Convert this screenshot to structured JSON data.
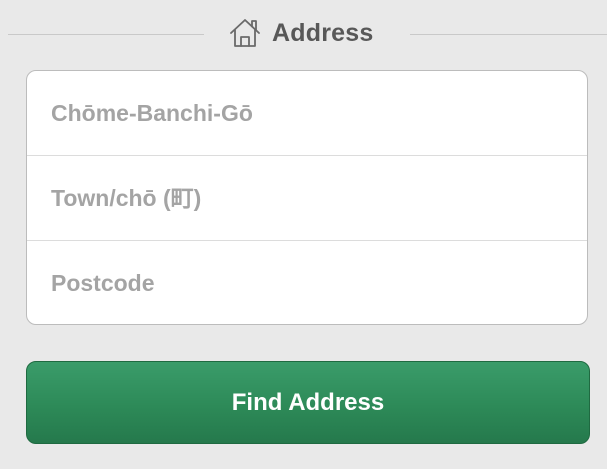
{
  "section_header": {
    "icon": "house-icon",
    "title": "Address"
  },
  "address_form": {
    "fields": [
      {
        "placeholder": "Chōme-Banchi-Gō",
        "value": ""
      },
      {
        "placeholder": "Town/chō (町)",
        "value": ""
      },
      {
        "placeholder": "Postcode",
        "value": ""
      }
    ]
  },
  "find_button": {
    "label": "Find Address"
  },
  "colors": {
    "background": "#e9e9e9",
    "accent_green": "#2d8a58",
    "header_text": "#585858",
    "placeholder_text": "#a4a4a4"
  }
}
